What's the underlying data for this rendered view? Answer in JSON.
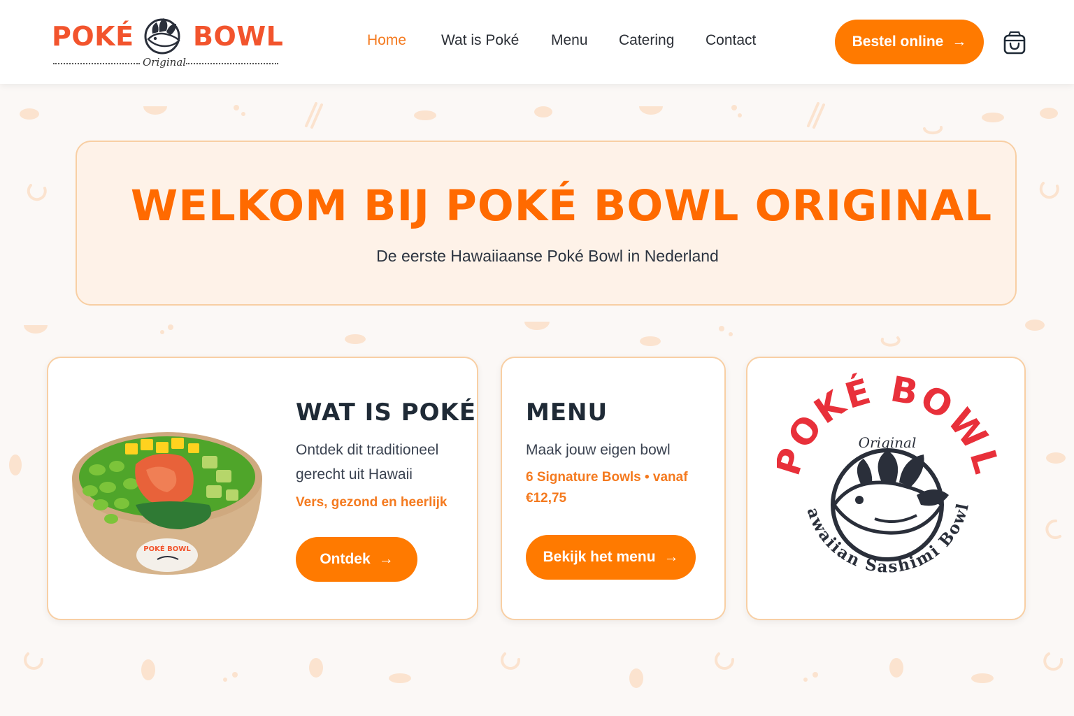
{
  "header": {
    "logo": {
      "word_left": "POKÉ",
      "word_right": "BOWL",
      "subtitle": "Original"
    },
    "nav": [
      {
        "label": "Home",
        "active": true
      },
      {
        "label": "Wat is Poké",
        "active": false
      },
      {
        "label": "Menu",
        "active": false
      },
      {
        "label": "Catering",
        "active": false
      },
      {
        "label": "Contact",
        "active": false
      }
    ],
    "order_button": {
      "label": "Bestel online",
      "icon": "arrow-right-icon"
    },
    "cart_icon": "shopping-bag-icon"
  },
  "hero": {
    "title": "WELKOM BIJ POKÉ BOWL ORIGINAL",
    "subtitle": "De eerste Hawaiiaanse Poké Bowl in Nederland"
  },
  "cards": {
    "wat_is_poke": {
      "title": "WAT IS POKÉ",
      "text_line1": "Ontdek dit traditioneel",
      "text_line2": "gerecht uit Hawaii",
      "accent": "Vers, gezond en heerlijk",
      "button": "Ontdek",
      "bowl_label": "POKÉ BOWL"
    },
    "menu": {
      "title": "MENU",
      "text": "Maak jouw eigen bowl",
      "accent_line1": "6 Signature Bowls • vanaf",
      "accent_line2": "€12,75",
      "button": "Bekijk het menu"
    },
    "emblem": {
      "arc_top": "POKÉ BOWL",
      "middle": "Original",
      "arc_bottom": "Hawaiian Sashimi Bowls"
    }
  },
  "colors": {
    "accent": "#ff7a00",
    "hero_title": "#ff6a00",
    "logo_red": "#f2542d",
    "emblem_red": "#e8303a",
    "card_border": "#f8cfa4",
    "dark": "#1f2a36"
  },
  "arrow_glyph": "→"
}
